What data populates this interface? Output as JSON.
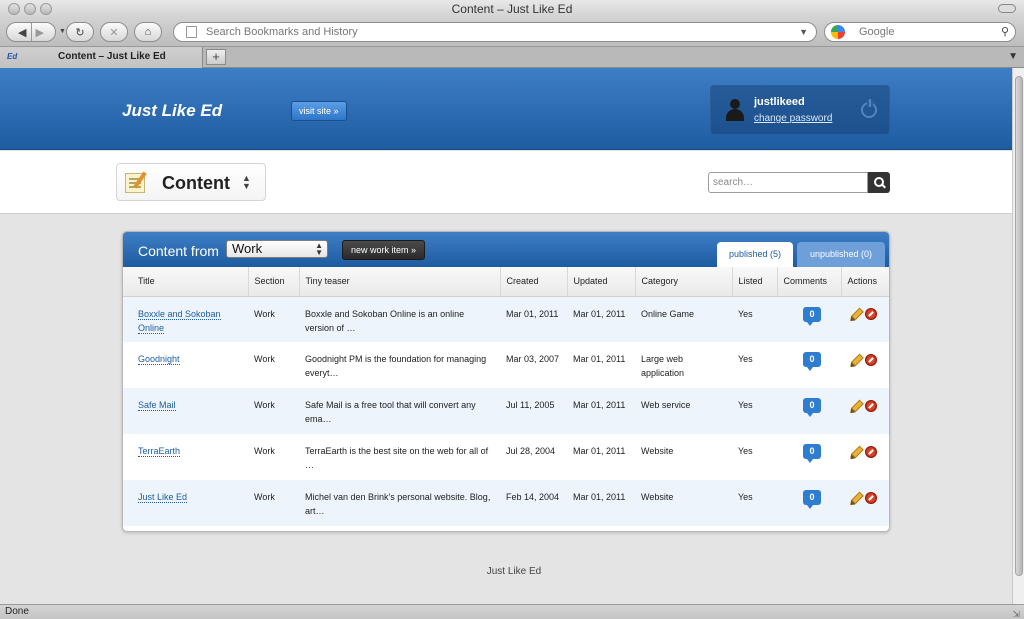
{
  "browser": {
    "window_title": "Content – Just Like Ed",
    "address_placeholder": "Search Bookmarks and History",
    "search_placeholder": "Google",
    "tab_title": "Content – Just Like Ed",
    "tab_favicon": "Ed",
    "new_tab": "+",
    "status": "Done"
  },
  "header": {
    "brand": "Just Like Ed",
    "visit_site": "visit site »",
    "username": "justlikeed",
    "change_password": "change password"
  },
  "subheader": {
    "title": "Content",
    "search_placeholder": "search…"
  },
  "panel": {
    "title": "Content from",
    "selected_section": "Work",
    "new_item": "new work item »",
    "tabs": {
      "published": "published (5)",
      "unpublished": "unpublished (0)"
    }
  },
  "table": {
    "columns": [
      "Title",
      "Section",
      "Tiny teaser",
      "Created",
      "Updated",
      "Category",
      "Listed",
      "Comments",
      "Actions"
    ],
    "rows": [
      {
        "title": "Boxxle and Sokoban Online",
        "section": "Work",
        "teaser": "Boxxle and Sokoban Online is an online version of …",
        "created": "Mar 01, 2011",
        "updated": "Mar 01, 2011",
        "category": "Online Game",
        "listed": "Yes",
        "comments": "0"
      },
      {
        "title": "Goodnight",
        "section": "Work",
        "teaser": "Goodnight PM is the foundation for managing everyt…",
        "created": "Mar 03, 2007",
        "updated": "Mar 01, 2011",
        "category": "Large web application",
        "listed": "Yes",
        "comments": "0"
      },
      {
        "title": "Safe Mail",
        "section": "Work",
        "teaser": "Safe Mail is a free tool that will convert any ema…",
        "created": "Jul 11, 2005",
        "updated": "Mar 01, 2011",
        "category": "Web service",
        "listed": "Yes",
        "comments": "0"
      },
      {
        "title": "TerraEarth",
        "section": "Work",
        "teaser": "TerraEarth is the best site on the web for all of …",
        "created": "Jul 28, 2004",
        "updated": "Mar 01, 2011",
        "category": "Website",
        "listed": "Yes",
        "comments": "0"
      },
      {
        "title": "Just Like Ed",
        "section": "Work",
        "teaser": "Michel van den Brink's personal website. Blog, art…",
        "created": "Feb 14, 2004",
        "updated": "Mar 01, 2011",
        "category": "Website",
        "listed": "Yes",
        "comments": "0"
      }
    ]
  },
  "footer": {
    "text": "Just Like Ed"
  }
}
